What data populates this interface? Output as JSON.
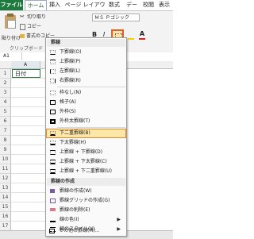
{
  "ribbon_tabs": {
    "file": "ファイル",
    "home": "ホーム",
    "insert": "挿入",
    "layout": "ページ レイアウト",
    "formulas": "数式",
    "data": "データ",
    "review": "校閲",
    "view": "表示"
  },
  "clipboard": {
    "paste": "貼り付け",
    "cut": "切り取り",
    "copy": "コピー",
    "format_painter": "書式のコピー",
    "group_label": "クリップボード"
  },
  "font": {
    "name": "ＭＳ Ｐゴシック"
  },
  "formula_bar": {
    "name_box": "A1"
  },
  "grid": {
    "col_a": "A",
    "a1_value": "日付",
    "rows": [
      "1",
      "2",
      "3",
      "4",
      "5",
      "6",
      "7",
      "8",
      "9",
      "10",
      "11",
      "12",
      "13",
      "14",
      "15",
      "16",
      "17",
      "18"
    ]
  },
  "menu": {
    "section_borders": "罫線",
    "bottom": "下罫線(O)",
    "top": "上罫線(P)",
    "left": "左罫線(L)",
    "right": "右罫線(R)",
    "no_border": "枠なし(N)",
    "all_borders": "格子(A)",
    "outside": "外枠(S)",
    "thick_outside": "外枠太罫線(T)",
    "bottom_double": "下二重罫線(B)",
    "thick_bottom": "下太罫線(H)",
    "top_bottom": "上罫線 + 下罫線(D)",
    "top_thick_bottom": "上罫線 + 下太罫線(C)",
    "top_double_bottom": "上罫線 + 下二重罫線(U)",
    "section_draw": "罫線の作成",
    "draw_border": "罫線の作成(W)",
    "draw_grid": "罫線グリッドの作成(G)",
    "erase": "罫線の削除(E)",
    "line_color": "線の色(I)",
    "line_style": "線のスタイル(Y)",
    "more": "その他の罫線(M)..."
  }
}
